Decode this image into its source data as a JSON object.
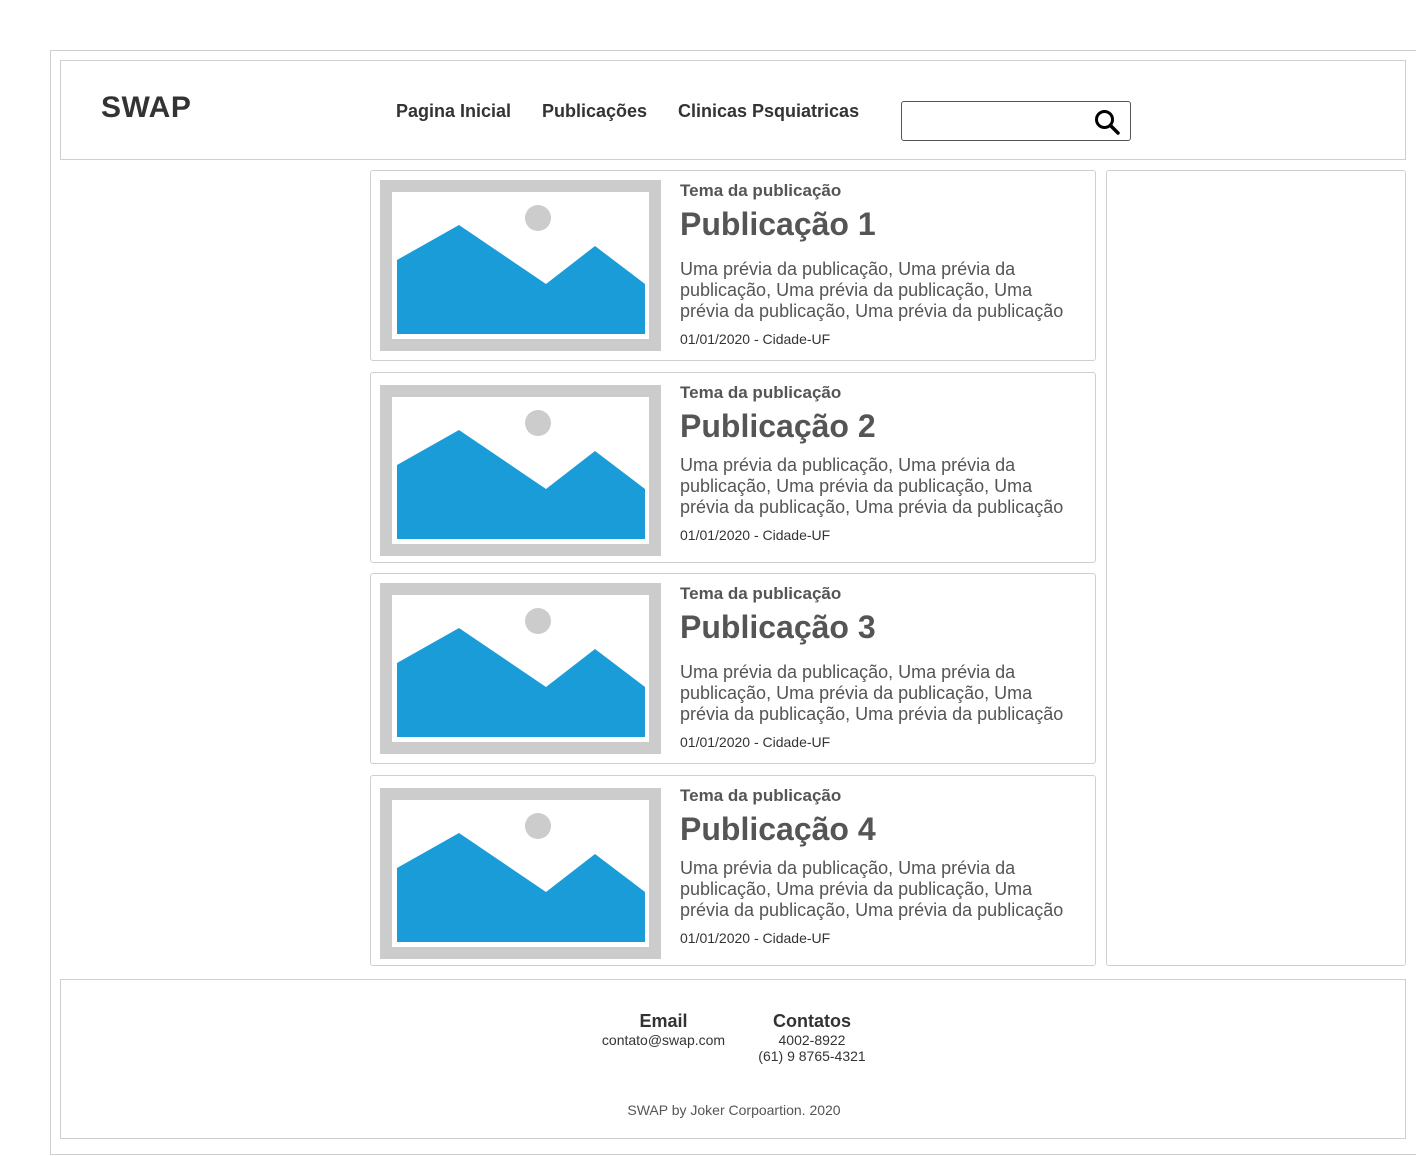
{
  "header": {
    "logo": "SWAP",
    "nav": [
      "Pagina Inicial",
      "Publicações",
      "Clinicas Psquiatricas"
    ],
    "search": {
      "value": "",
      "placeholder": "",
      "icon": "search-icon"
    }
  },
  "posts": [
    {
      "topic": "Tema da publicação",
      "title": "Publicação 1",
      "preview": "Uma prévia da publicação, Uma prévia da publicação, Uma prévia da publicação, Uma prévia da publicação, Uma prévia da publicação",
      "meta": "01/01/2020 - Cidade-UF",
      "image_icon": "image-placeholder-icon"
    },
    {
      "topic": "Tema da publicação",
      "title": "Publicação 2",
      "preview": "Uma prévia da publicação, Uma prévia da publicação, Uma prévia da publicação, Uma prévia da publicação, Uma prévia da publicação",
      "meta": "01/01/2020 - Cidade-UF",
      "image_icon": "image-placeholder-icon"
    },
    {
      "topic": "Tema da publicação",
      "title": "Publicação 3",
      "preview": "Uma prévia da publicação, Uma prévia da publicação, Uma prévia da publicação, Uma prévia da publicação, Uma prévia da publicação",
      "meta": "01/01/2020 - Cidade-UF",
      "image_icon": "image-placeholder-icon"
    },
    {
      "topic": "Tema da publicação",
      "title": "Publicação 4",
      "preview": "Uma prévia da publicação, Uma prévia da publicação, Uma prévia da publicação, Uma prévia da publicação, Uma prévia da publicação",
      "meta": "01/01/2020 - Cidade-UF",
      "image_icon": "image-placeholder-icon"
    }
  ],
  "footer": {
    "email_heading": "Email",
    "email": "contato@swap.com",
    "contacts_heading": "Contatos",
    "phone_1": "4002-8922",
    "phone_2": "(61) 9 8765-4321",
    "copyright": "SWAP by Joker Corpoartion. 2020"
  },
  "colors": {
    "image_frame": "#cccccc",
    "image_mountain": "#1a9cd8",
    "border": "#cfcfcf",
    "text": "#333333",
    "muted_text": "#555555"
  }
}
